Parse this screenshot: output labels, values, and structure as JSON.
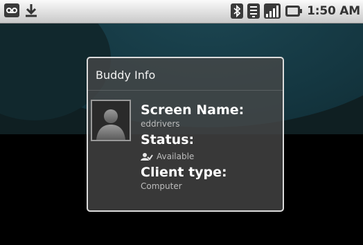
{
  "status_bar": {
    "time": "1:50 AM",
    "left_icons": [
      "voicemail-icon",
      "download-icon"
    ],
    "right_icons": [
      "bluetooth-icon",
      "wifi-icon",
      "signal-icon",
      "battery-icon"
    ]
  },
  "dialog": {
    "title": "Buddy Info",
    "screen_name_label": "Screen Name:",
    "screen_name_value": "eddrivers",
    "status_label": "Status:",
    "status_value": "Available",
    "status_icon": "buddy-available-icon",
    "client_type_label": "Client type:",
    "client_type_value": "Computer"
  }
}
